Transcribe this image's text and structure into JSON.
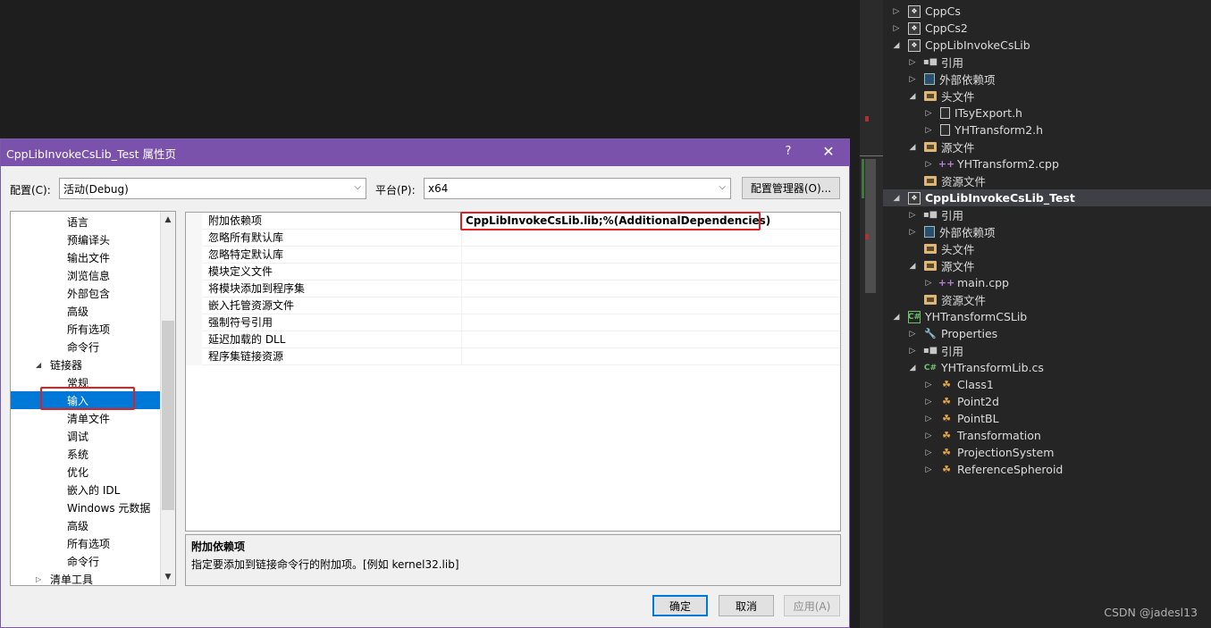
{
  "dialog": {
    "title": "CppLibInvokeCsLib_Test 属性页",
    "help": "?",
    "close": "✕",
    "config_label": "配置(C):",
    "config_value": "活动(Debug)",
    "platform_label": "平台(P):",
    "platform_value": "x64",
    "config_manager_button": "配置管理器(O)...",
    "ok_button": "确定",
    "cancel_button": "取消",
    "apply_button": "应用(A)"
  },
  "tree": {
    "items": [
      {
        "label": "语言",
        "level": 2
      },
      {
        "label": "预编译头",
        "level": 2
      },
      {
        "label": "输出文件",
        "level": 2
      },
      {
        "label": "浏览信息",
        "level": 2
      },
      {
        "label": "外部包含",
        "level": 2
      },
      {
        "label": "高级",
        "level": 2
      },
      {
        "label": "所有选项",
        "level": 2
      },
      {
        "label": "命令行",
        "level": 2
      },
      {
        "label": "链接器",
        "level": 1,
        "expanded": true
      },
      {
        "label": "常规",
        "level": 2
      },
      {
        "label": "输入",
        "level": 2,
        "selected": true
      },
      {
        "label": "清单文件",
        "level": 2
      },
      {
        "label": "调试",
        "level": 2
      },
      {
        "label": "系统",
        "level": 2
      },
      {
        "label": "优化",
        "level": 2
      },
      {
        "label": "嵌入的 IDL",
        "level": 2
      },
      {
        "label": "Windows 元数据",
        "level": 2
      },
      {
        "label": "高级",
        "level": 2
      },
      {
        "label": "所有选项",
        "level": 2
      },
      {
        "label": "命令行",
        "level": 2
      },
      {
        "label": "清单工具",
        "level": 1,
        "expanded": false
      }
    ]
  },
  "grid": {
    "rows": [
      {
        "name": "附加依赖项",
        "value": "CppLibInvokeCsLib.lib;%(AdditionalDependencies)"
      },
      {
        "name": "忽略所有默认库",
        "value": ""
      },
      {
        "name": "忽略特定默认库",
        "value": ""
      },
      {
        "name": "模块定义文件",
        "value": ""
      },
      {
        "name": "将模块添加到程序集",
        "value": ""
      },
      {
        "name": "嵌入托管资源文件",
        "value": ""
      },
      {
        "name": "强制符号引用",
        "value": ""
      },
      {
        "name": "延迟加载的 DLL",
        "value": ""
      },
      {
        "name": "程序集链接资源",
        "value": ""
      }
    ]
  },
  "description": {
    "title": "附加依赖项",
    "text": "指定要添加到链接命令行的附加项。[例如 kernel32.lib]"
  },
  "solution": {
    "nodes": [
      {
        "label": "CppCs",
        "indent": 0,
        "arrow": "right",
        "icon": "project"
      },
      {
        "label": "CppCs2",
        "indent": 0,
        "arrow": "right",
        "icon": "project"
      },
      {
        "label": "CppLibInvokeCsLib",
        "indent": 0,
        "arrow": "down",
        "icon": "project"
      },
      {
        "label": "引用",
        "indent": 1,
        "arrow": "right",
        "icon": "reference"
      },
      {
        "label": "外部依赖项",
        "indent": 1,
        "arrow": "right",
        "icon": "external"
      },
      {
        "label": "头文件",
        "indent": 1,
        "arrow": "down",
        "icon": "folder"
      },
      {
        "label": "ITsyExport.h",
        "indent": 2,
        "arrow": "right",
        "icon": "file"
      },
      {
        "label": "YHTransform2.h",
        "indent": 2,
        "arrow": "right",
        "icon": "file"
      },
      {
        "label": "源文件",
        "indent": 1,
        "arrow": "down",
        "icon": "folder"
      },
      {
        "label": "YHTransform2.cpp",
        "indent": 2,
        "arrow": "right",
        "icon": "cpp"
      },
      {
        "label": "资源文件",
        "indent": 1,
        "arrow": "none",
        "icon": "folder"
      },
      {
        "label": "CppLibInvokeCsLib_Test",
        "indent": 0,
        "arrow": "down",
        "icon": "project",
        "selected": true
      },
      {
        "label": "引用",
        "indent": 1,
        "arrow": "right",
        "icon": "reference"
      },
      {
        "label": "外部依赖项",
        "indent": 1,
        "arrow": "right",
        "icon": "external"
      },
      {
        "label": "头文件",
        "indent": 1,
        "arrow": "none",
        "icon": "folder"
      },
      {
        "label": "源文件",
        "indent": 1,
        "arrow": "down",
        "icon": "folder"
      },
      {
        "label": "main.cpp",
        "indent": 2,
        "arrow": "right",
        "icon": "cpp"
      },
      {
        "label": "资源文件",
        "indent": 1,
        "arrow": "none",
        "icon": "folder"
      },
      {
        "label": "YHTransformCSLib",
        "indent": 0,
        "arrow": "down",
        "icon": "csproject"
      },
      {
        "label": "Properties",
        "indent": 1,
        "arrow": "right",
        "icon": "wrench"
      },
      {
        "label": "引用",
        "indent": 1,
        "arrow": "right",
        "icon": "reference"
      },
      {
        "label": "YHTransformLib.cs",
        "indent": 1,
        "arrow": "down",
        "icon": "csfile"
      },
      {
        "label": "Class1",
        "indent": 2,
        "arrow": "right",
        "icon": "class"
      },
      {
        "label": "Point2d",
        "indent": 2,
        "arrow": "right",
        "icon": "class"
      },
      {
        "label": "PointBL",
        "indent": 2,
        "arrow": "right",
        "icon": "class"
      },
      {
        "label": "Transformation",
        "indent": 2,
        "arrow": "right",
        "icon": "class"
      },
      {
        "label": "ProjectionSystem",
        "indent": 2,
        "arrow": "right",
        "icon": "class"
      },
      {
        "label": "ReferenceSpheroid",
        "indent": 2,
        "arrow": "right",
        "icon": "class"
      }
    ]
  },
  "watermark": "CSDN @jadesl13"
}
